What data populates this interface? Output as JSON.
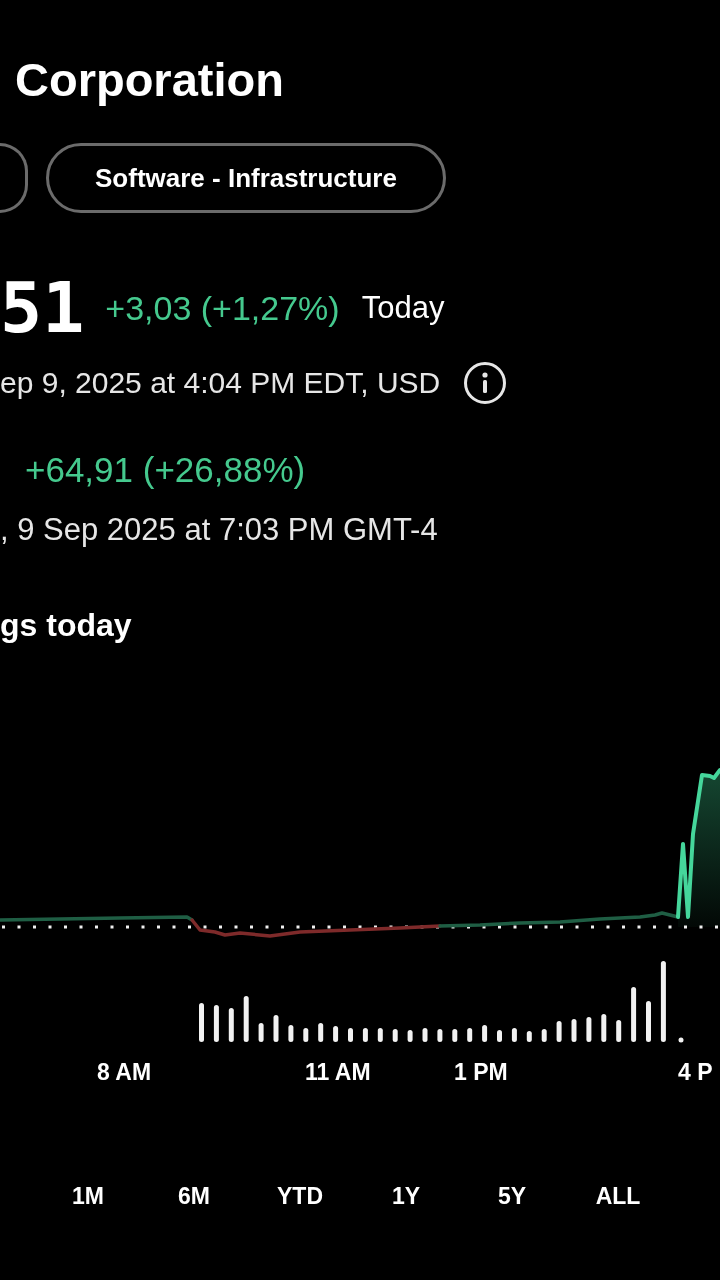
{
  "header": {
    "title": "Corporation",
    "tags": [
      "Software - Infrastructure"
    ]
  },
  "quote": {
    "price": "51",
    "change": "+3,03 (+1,27%)",
    "positive": true,
    "period": "Today",
    "timestamp": "ep 9, 2025 at 4:04 PM EDT, USD"
  },
  "after_hours": {
    "change": "+64,91 (+26,88%)",
    "positive": true,
    "timestamp": ", 9 Sep 2025 at 7:03 PM GMT-4"
  },
  "earnings_note": "gs today",
  "chart": {
    "x_labels": [
      "8 AM",
      "11 AM",
      "1 PM",
      "4 P"
    ]
  },
  "ranges": [
    {
      "label": "1M",
      "selected": false
    },
    {
      "label": "6M",
      "selected": false
    },
    {
      "label": "YTD",
      "selected": false
    },
    {
      "label": "1Y",
      "selected": false
    },
    {
      "label": "5Y",
      "selected": false
    },
    {
      "label": "ALL",
      "selected": false
    }
  ]
}
